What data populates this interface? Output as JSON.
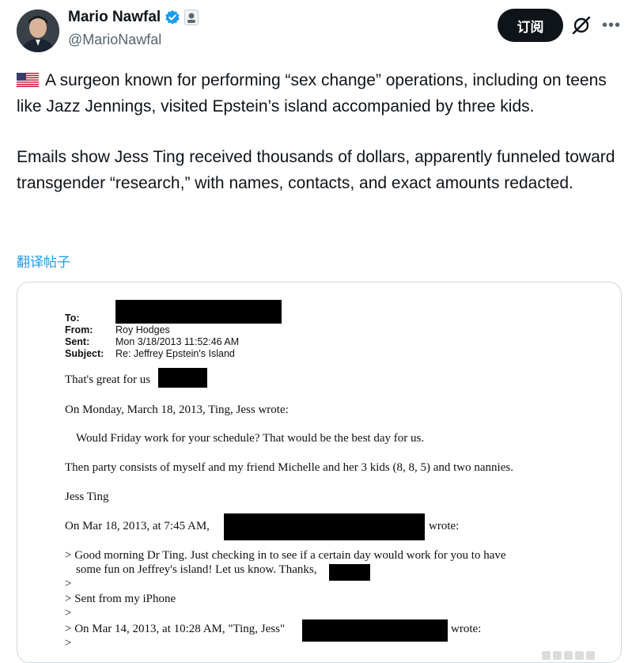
{
  "author": {
    "display_name": "Mario Nawfal",
    "handle": "@MarioNawfal"
  },
  "actions": {
    "subscribe_label": "订阅",
    "grok_icon": "grok-icon",
    "more_icon": "more-icon"
  },
  "post": {
    "paragraph1": "A surgeon known for performing “sex change” operations, including on teens like Jazz Jennings, visited Epstein’s island accompanied by three kids.",
    "paragraph2": "Emails show Jess Ting received thousands of dollars, apparently funneled toward transgender “research,” with names, contacts, and exact amounts redacted.",
    "translate_label": "翻译帖子"
  },
  "document": {
    "to_label": "To:",
    "from_label": "From:",
    "from_value": "Roy Hodges",
    "sent_label": "Sent:",
    "sent_value": "Mon 3/18/2013 11:52:46 AM",
    "subject_label": "Subject:",
    "subject_value": "Re: Jeffrey Epstein's Island",
    "line1": "That's great for us",
    "line2": "On Monday, March 18, 2013, Ting, Jess wrote:",
    "line3": "Would Friday work for your schedule? That would be the best day for us.",
    "line4": "Then party consists of myself and my friend Michelle and her 3 kids (8, 8, 5) and two nannies.",
    "line5": "Jess Ting",
    "line6a": "On Mar 18, 2013, at 7:45 AM,",
    "line6b": "wrote:",
    "line7": "> Good morning Dr Ting. Just checking in to see if a certain day would work for you to have",
    "line8": "some fun on Jeffrey's island! Let us know. Thanks,",
    "line9": ">",
    "line10": "> Sent from my iPhone",
    "line11": ">",
    "line12a": "> On Mar 14, 2013, at 10:28 AM, \"Ting, Jess\"",
    "line12b": "wrote:",
    "line13": ">"
  },
  "colors": {
    "accent": "#1d9bf0",
    "text": "#0f1419",
    "secondary": "#536471",
    "border": "#cfd9de"
  }
}
